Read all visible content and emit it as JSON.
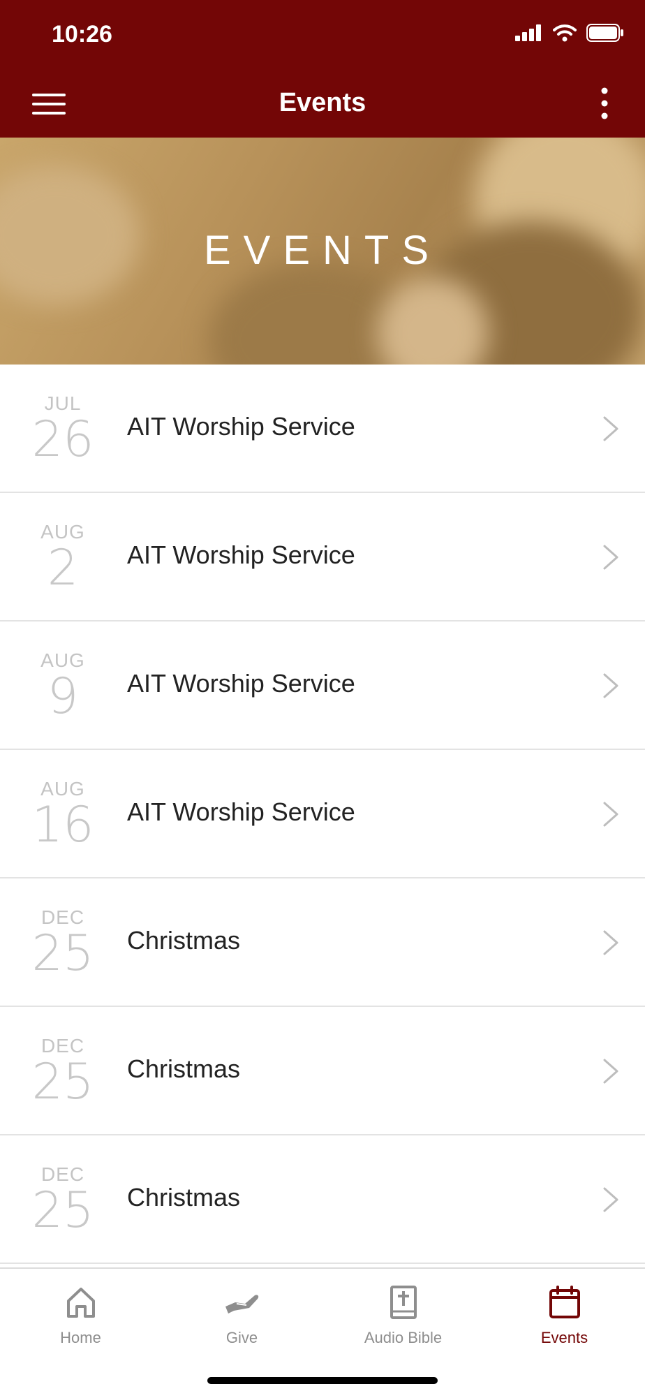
{
  "status_bar": {
    "time": "10:26"
  },
  "nav": {
    "title": "Events"
  },
  "hero": {
    "title": "EVENTS"
  },
  "events": [
    {
      "month": "JUL",
      "day": "26",
      "name": "AIT Worship Service"
    },
    {
      "month": "AUG",
      "day": "2",
      "name": "AIT Worship Service"
    },
    {
      "month": "AUG",
      "day": "9",
      "name": "AIT Worship Service"
    },
    {
      "month": "AUG",
      "day": "16",
      "name": "AIT Worship Service"
    },
    {
      "month": "DEC",
      "day": "25",
      "name": "Christmas"
    },
    {
      "month": "DEC",
      "day": "25",
      "name": "Christmas"
    },
    {
      "month": "DEC",
      "day": "25",
      "name": "Christmas"
    }
  ],
  "tabs": [
    {
      "label": "Home",
      "icon": "home-icon"
    },
    {
      "label": "Give",
      "icon": "give-hand-icon"
    },
    {
      "label": "Audio Bible",
      "icon": "bible-icon"
    },
    {
      "label": "Events",
      "icon": "calendar-icon",
      "active": true
    }
  ],
  "colors": {
    "brand": "#730606",
    "inactive": "#8e8e8e"
  }
}
